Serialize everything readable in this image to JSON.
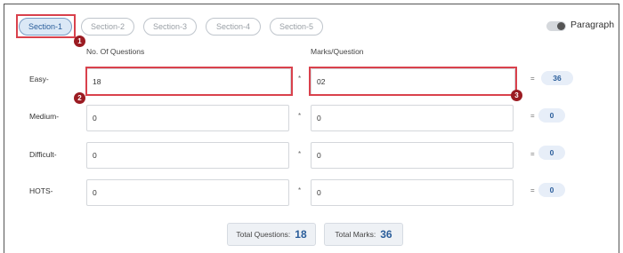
{
  "tabs": [
    {
      "label": "Section-1",
      "active": true
    },
    {
      "label": "Section-2",
      "active": false
    },
    {
      "label": "Section-3",
      "active": false
    },
    {
      "label": "Section-4",
      "active": false
    },
    {
      "label": "Section-5",
      "active": false
    }
  ],
  "paragraph_toggle": {
    "label": "Paragraph",
    "on": false
  },
  "columns": {
    "questions": "No. Of Questions",
    "marks": "Marks/Question"
  },
  "operators": {
    "multiply": "*",
    "equals": "="
  },
  "rows": [
    {
      "label": "Easy-",
      "questions": "18",
      "marks": "02",
      "result": "36"
    },
    {
      "label": "Medium-",
      "questions": "0",
      "marks": "0",
      "result": "0"
    },
    {
      "label": "Difficult-",
      "questions": "0",
      "marks": "0",
      "result": "0"
    },
    {
      "label": "HOTS-",
      "questions": "0",
      "marks": "0",
      "result": "0"
    }
  ],
  "totals": {
    "questions_label": "Total Questions:",
    "questions_value": "18",
    "marks_label": "Total Marks:",
    "marks_value": "36"
  },
  "annotations": [
    "1",
    "2",
    "3"
  ],
  "colors": {
    "highlight": "#d9414c",
    "marker": "#9b1b22",
    "accent": "#2a5d9a"
  }
}
